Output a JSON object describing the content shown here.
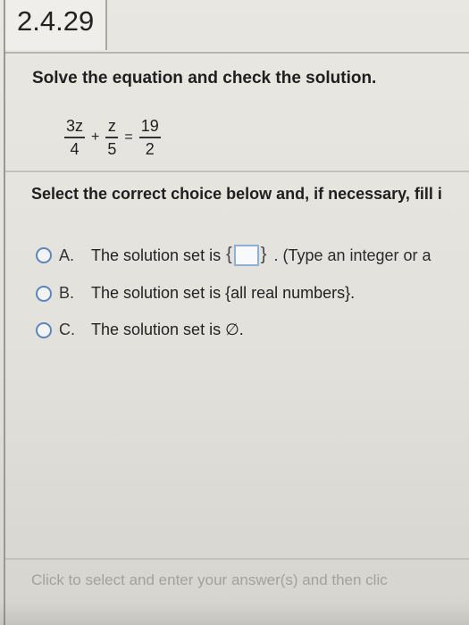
{
  "question_number": "2.4.29",
  "instruction": "Solve the equation and check the solution.",
  "equation": {
    "left_fraction_1": {
      "numerator": "3z",
      "denominator": "4"
    },
    "operator_1": "+",
    "left_fraction_2": {
      "numerator": "z",
      "denominator": "5"
    },
    "operator_2": "=",
    "right_fraction": {
      "numerator": "19",
      "denominator": "2"
    }
  },
  "select_prompt": "Select the correct choice below and, if necessary, fill i",
  "choices": [
    {
      "letter": "A.",
      "text": "The solution set is",
      "open_brace": "{",
      "close_brace": "}",
      "hint": ". (Type an integer or a"
    },
    {
      "letter": "B.",
      "text": "The solution set is {all real numbers}."
    },
    {
      "letter": "C.",
      "text": "The solution set is ∅."
    }
  ],
  "footer_instruction": "Click to select and enter your answer(s) and then clic",
  "colors": {
    "radio_border": "#5c86b8",
    "answer_box_border": "#8fb0d6",
    "footer_text": "#a3a19c"
  }
}
